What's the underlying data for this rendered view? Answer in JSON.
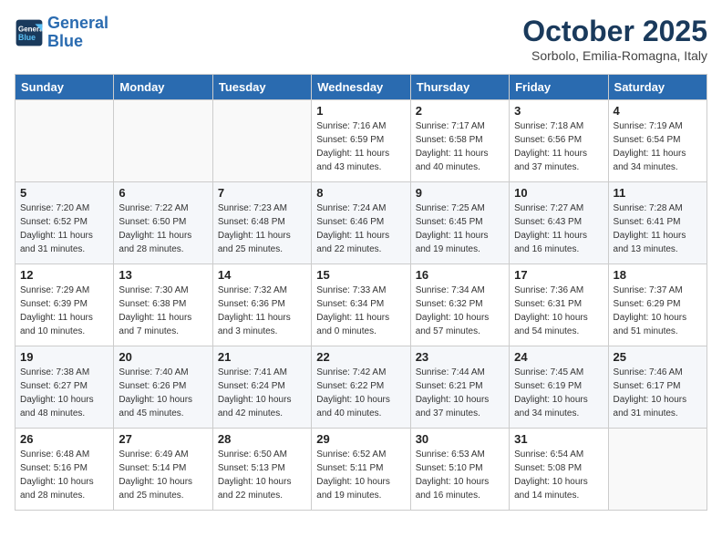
{
  "logo": {
    "line1": "General",
    "line2": "Blue"
  },
  "title": "October 2025",
  "subtitle": "Sorbolo, Emilia-Romagna, Italy",
  "days_of_week": [
    "Sunday",
    "Monday",
    "Tuesday",
    "Wednesday",
    "Thursday",
    "Friday",
    "Saturday"
  ],
  "weeks": [
    [
      {
        "day": "",
        "info": ""
      },
      {
        "day": "",
        "info": ""
      },
      {
        "day": "",
        "info": ""
      },
      {
        "day": "1",
        "info": "Sunrise: 7:16 AM\nSunset: 6:59 PM\nDaylight: 11 hours and 43 minutes."
      },
      {
        "day": "2",
        "info": "Sunrise: 7:17 AM\nSunset: 6:58 PM\nDaylight: 11 hours and 40 minutes."
      },
      {
        "day": "3",
        "info": "Sunrise: 7:18 AM\nSunset: 6:56 PM\nDaylight: 11 hours and 37 minutes."
      },
      {
        "day": "4",
        "info": "Sunrise: 7:19 AM\nSunset: 6:54 PM\nDaylight: 11 hours and 34 minutes."
      }
    ],
    [
      {
        "day": "5",
        "info": "Sunrise: 7:20 AM\nSunset: 6:52 PM\nDaylight: 11 hours and 31 minutes."
      },
      {
        "day": "6",
        "info": "Sunrise: 7:22 AM\nSunset: 6:50 PM\nDaylight: 11 hours and 28 minutes."
      },
      {
        "day": "7",
        "info": "Sunrise: 7:23 AM\nSunset: 6:48 PM\nDaylight: 11 hours and 25 minutes."
      },
      {
        "day": "8",
        "info": "Sunrise: 7:24 AM\nSunset: 6:46 PM\nDaylight: 11 hours and 22 minutes."
      },
      {
        "day": "9",
        "info": "Sunrise: 7:25 AM\nSunset: 6:45 PM\nDaylight: 11 hours and 19 minutes."
      },
      {
        "day": "10",
        "info": "Sunrise: 7:27 AM\nSunset: 6:43 PM\nDaylight: 11 hours and 16 minutes."
      },
      {
        "day": "11",
        "info": "Sunrise: 7:28 AM\nSunset: 6:41 PM\nDaylight: 11 hours and 13 minutes."
      }
    ],
    [
      {
        "day": "12",
        "info": "Sunrise: 7:29 AM\nSunset: 6:39 PM\nDaylight: 11 hours and 10 minutes."
      },
      {
        "day": "13",
        "info": "Sunrise: 7:30 AM\nSunset: 6:38 PM\nDaylight: 11 hours and 7 minutes."
      },
      {
        "day": "14",
        "info": "Sunrise: 7:32 AM\nSunset: 6:36 PM\nDaylight: 11 hours and 3 minutes."
      },
      {
        "day": "15",
        "info": "Sunrise: 7:33 AM\nSunset: 6:34 PM\nDaylight: 11 hours and 0 minutes."
      },
      {
        "day": "16",
        "info": "Sunrise: 7:34 AM\nSunset: 6:32 PM\nDaylight: 10 hours and 57 minutes."
      },
      {
        "day": "17",
        "info": "Sunrise: 7:36 AM\nSunset: 6:31 PM\nDaylight: 10 hours and 54 minutes."
      },
      {
        "day": "18",
        "info": "Sunrise: 7:37 AM\nSunset: 6:29 PM\nDaylight: 10 hours and 51 minutes."
      }
    ],
    [
      {
        "day": "19",
        "info": "Sunrise: 7:38 AM\nSunset: 6:27 PM\nDaylight: 10 hours and 48 minutes."
      },
      {
        "day": "20",
        "info": "Sunrise: 7:40 AM\nSunset: 6:26 PM\nDaylight: 10 hours and 45 minutes."
      },
      {
        "day": "21",
        "info": "Sunrise: 7:41 AM\nSunset: 6:24 PM\nDaylight: 10 hours and 42 minutes."
      },
      {
        "day": "22",
        "info": "Sunrise: 7:42 AM\nSunset: 6:22 PM\nDaylight: 10 hours and 40 minutes."
      },
      {
        "day": "23",
        "info": "Sunrise: 7:44 AM\nSunset: 6:21 PM\nDaylight: 10 hours and 37 minutes."
      },
      {
        "day": "24",
        "info": "Sunrise: 7:45 AM\nSunset: 6:19 PM\nDaylight: 10 hours and 34 minutes."
      },
      {
        "day": "25",
        "info": "Sunrise: 7:46 AM\nSunset: 6:17 PM\nDaylight: 10 hours and 31 minutes."
      }
    ],
    [
      {
        "day": "26",
        "info": "Sunrise: 6:48 AM\nSunset: 5:16 PM\nDaylight: 10 hours and 28 minutes."
      },
      {
        "day": "27",
        "info": "Sunrise: 6:49 AM\nSunset: 5:14 PM\nDaylight: 10 hours and 25 minutes."
      },
      {
        "day": "28",
        "info": "Sunrise: 6:50 AM\nSunset: 5:13 PM\nDaylight: 10 hours and 22 minutes."
      },
      {
        "day": "29",
        "info": "Sunrise: 6:52 AM\nSunset: 5:11 PM\nDaylight: 10 hours and 19 minutes."
      },
      {
        "day": "30",
        "info": "Sunrise: 6:53 AM\nSunset: 5:10 PM\nDaylight: 10 hours and 16 minutes."
      },
      {
        "day": "31",
        "info": "Sunrise: 6:54 AM\nSunset: 5:08 PM\nDaylight: 10 hours and 14 minutes."
      },
      {
        "day": "",
        "info": ""
      }
    ]
  ]
}
